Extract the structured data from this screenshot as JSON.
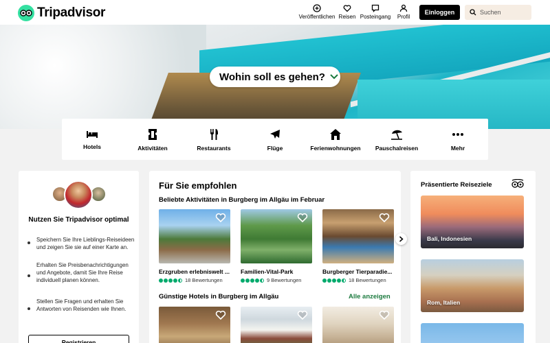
{
  "header": {
    "logo_text": "Tripadvisor",
    "nav": [
      {
        "label": "Veröffentlichen",
        "icon": "plus-circle-icon"
      },
      {
        "label": "Reisen",
        "icon": "heart-icon"
      },
      {
        "label": "Posteingang",
        "icon": "message-icon"
      },
      {
        "label": "Profil",
        "icon": "user-icon"
      }
    ],
    "login_label": "Einloggen",
    "search_placeholder": "Suchen"
  },
  "hero": {
    "prompt": "Wohin soll es gehen?"
  },
  "categories": [
    {
      "label": "Hotels",
      "icon": "bed-icon"
    },
    {
      "label": "Aktivitäten",
      "icon": "ticket-icon"
    },
    {
      "label": "Restaurants",
      "icon": "cutlery-icon"
    },
    {
      "label": "Flüge",
      "icon": "plane-icon"
    },
    {
      "label": "Ferienwohnungen",
      "icon": "house-icon"
    },
    {
      "label": "Pauschalreisen",
      "icon": "beach-umbrella-icon"
    },
    {
      "label": "Mehr",
      "icon": "more-dots-icon"
    }
  ],
  "left_card": {
    "title": "Nutzen Sie Tripadvisor optimal",
    "items": [
      "Speichern Sie Ihre Lieblings-Reiseideen und zeigen Sie sie auf einer Karte an.",
      "Erhalten Sie Preisbenachrichtigungen und Angebote, damit Sie Ihre Reise individuell planen können.",
      "Stellen Sie Fragen und erhalten Sie Antworten von Reisenden wie Ihnen."
    ],
    "register_label": "Registrieren"
  },
  "recommended": {
    "title": "Für Sie empfohlen",
    "activities_heading": "Beliebte Aktivitäten in Burgberg im Allgäu im Februar",
    "activities": [
      {
        "name": "Erzgruben erlebniswelt ...",
        "reviews": "18 Bewertungen",
        "rating": 4.5
      },
      {
        "name": "Familien-Vital-Park",
        "reviews": "9 Bewertungen",
        "rating": 4.5
      },
      {
        "name": "Burgberger Tierparadie...",
        "reviews": "18 Bewertungen",
        "rating": 4.5
      }
    ],
    "hotels_heading": "Günstige Hotels in Burgberg im Allgäu",
    "hotels_all_label": "Alle anzeigen"
  },
  "featured": {
    "title": "Präsentierte Reiseziele",
    "destinations": [
      {
        "label": "Bali, Indonesien"
      },
      {
        "label": "Rom, Italien"
      }
    ]
  },
  "colors": {
    "brand_green": "#34e0a1",
    "rating_green": "#00aa6c",
    "link_green": "#1b7a3e"
  }
}
